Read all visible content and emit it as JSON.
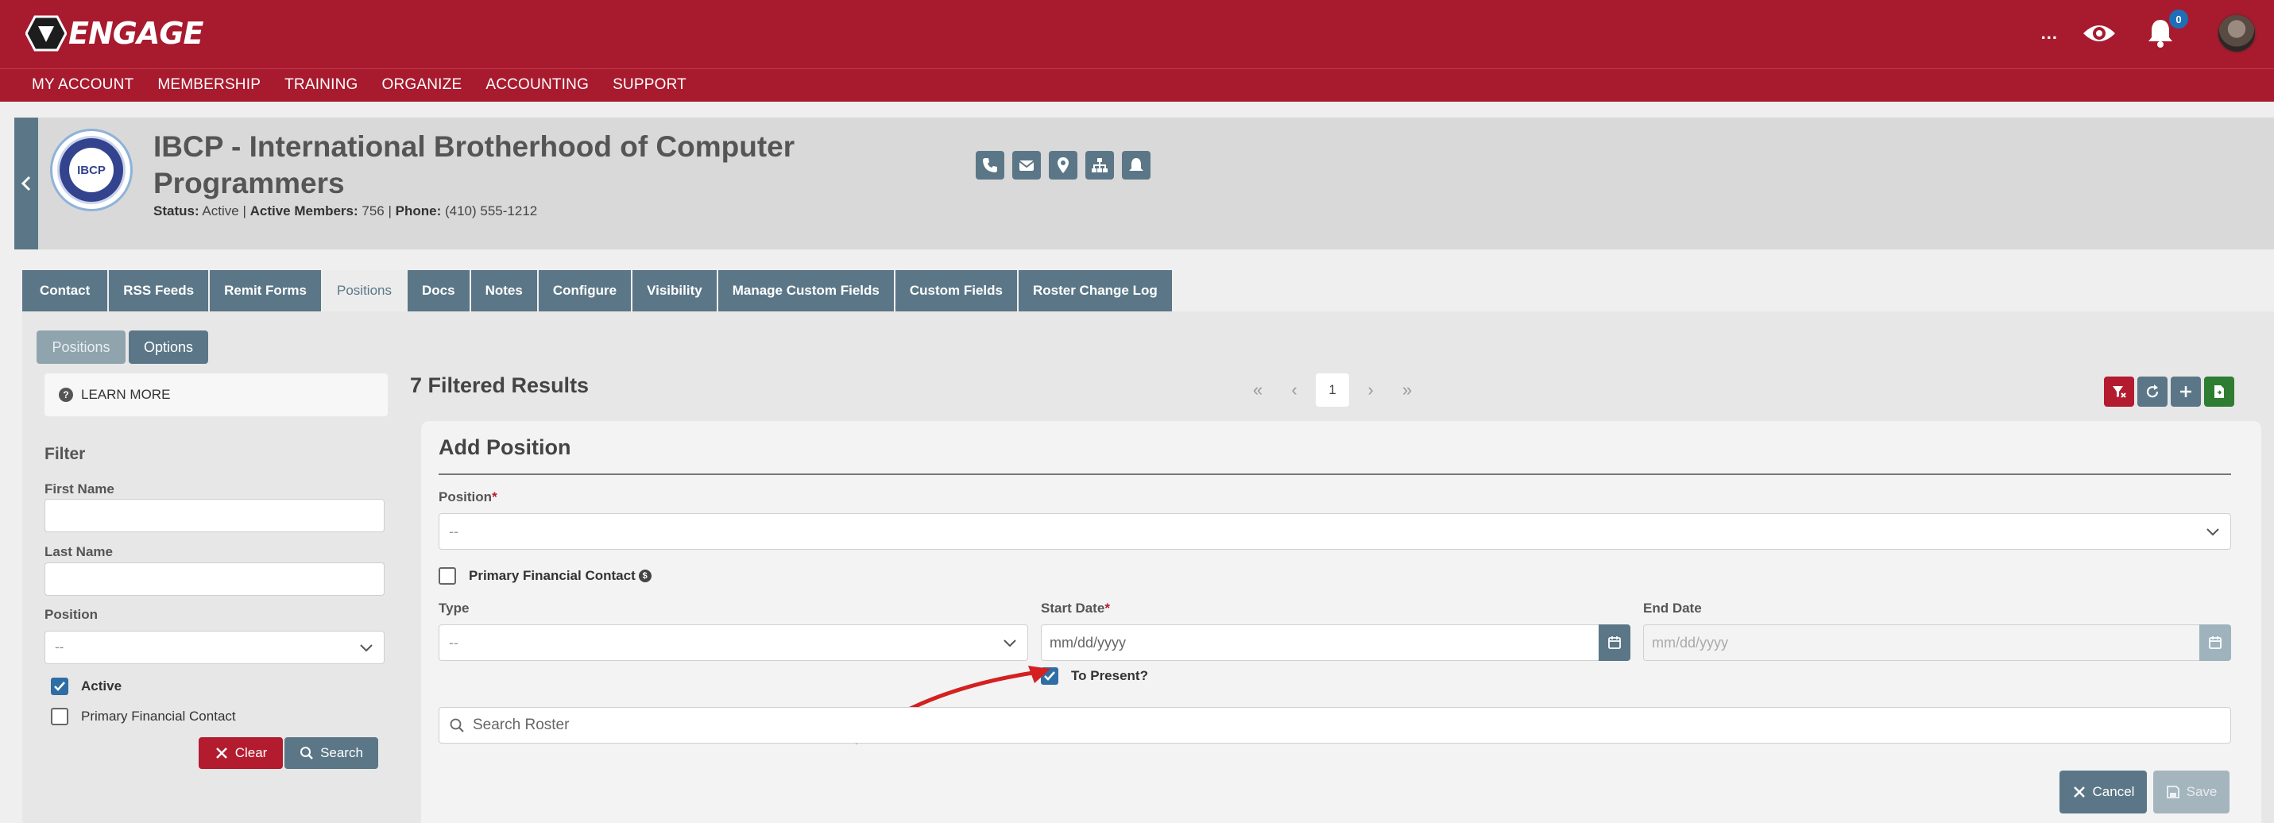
{
  "app": {
    "logo_text": "ENGAGE",
    "notifications_count": "0",
    "more_label": "..."
  },
  "main_nav": [
    "MY ACCOUNT",
    "MEMBERSHIP",
    "TRAINING",
    "ORGANIZE",
    "ACCOUNTING",
    "SUPPORT"
  ],
  "org": {
    "logo_text": "IBCP",
    "name": "IBCP - International Brotherhood of Computer Programmers",
    "status_label": "Status:",
    "status_value": "Active",
    "members_label": "Active Members:",
    "members_value": "756",
    "phone_label": "Phone:",
    "phone_value": "(410) 555-1212"
  },
  "tabs": [
    "Contact",
    "RSS Feeds",
    "Remit Forms",
    "Positions",
    "Docs",
    "Notes",
    "Configure",
    "Visibility",
    "Manage Custom Fields",
    "Custom Fields",
    "Roster Change Log"
  ],
  "subnav": {
    "positions": "Positions",
    "options": "Options"
  },
  "filter": {
    "learn_more": "LEARN MORE",
    "title": "Filter",
    "first_name_label": "First Name",
    "last_name_label": "Last Name",
    "position_label": "Position",
    "position_value": "--",
    "active_label": "Active",
    "primary_label": "Primary Financial Contact",
    "clear_label": "Clear",
    "search_label": "Search"
  },
  "results": {
    "summary": "7 Filtered Results",
    "current_page": "1"
  },
  "form": {
    "title": "Add Position",
    "position_label": "Position",
    "required_mark": "*",
    "position_value": "--",
    "primary_label": "Primary Financial Contact",
    "type_label": "Type",
    "type_value": "--",
    "start_label": "Start Date",
    "start_placeholder": "mm/dd/yyyy",
    "end_label": "End Date",
    "end_placeholder": "mm/dd/yyyy",
    "to_present_label": "To Present?",
    "search_placeholder": "Search Roster",
    "cancel_label": "Cancel",
    "save_label": "Save"
  },
  "colors": {
    "brand_red": "#a81a2e",
    "slate": "#5b7787",
    "green": "#2e7d32"
  }
}
